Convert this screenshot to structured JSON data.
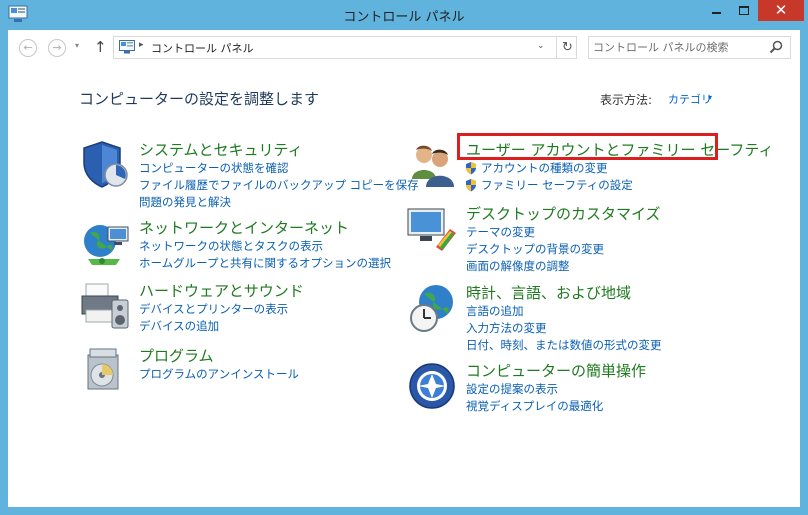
{
  "window": {
    "title": "コントロール パネル",
    "close_glyph": "✕"
  },
  "nav": {
    "back_glyph": "←",
    "forward_glyph": "→",
    "dropdown_glyph": "▾",
    "up_glyph": "↑",
    "separator": "▸",
    "address": "コントロール パネル",
    "address_dropdown": "⌄",
    "refresh_glyph": "↻",
    "search_placeholder": "コントロール パネルの検索"
  },
  "page": {
    "heading": "コンピューターの設定を調整します",
    "view_by_label": "表示方法:",
    "view_by_value": "カテゴリ",
    "view_by_arrow": "▾"
  },
  "categories_left": [
    {
      "title": "システムとセキュリティ",
      "icon": "shield-icon",
      "links": [
        "コンピューターの状態を確認",
        "ファイル履歴でファイルのバックアップ コピーを保存",
        "問題の発見と解決"
      ]
    },
    {
      "title": "ネットワークとインターネット",
      "icon": "network-globe-icon",
      "links": [
        "ネットワークの状態とタスクの表示",
        "ホームグループと共有に関するオプションの選択"
      ]
    },
    {
      "title": "ハードウェアとサウンド",
      "icon": "printer-speaker-icon",
      "links": [
        "デバイスとプリンターの表示",
        "デバイスの追加"
      ]
    },
    {
      "title": "プログラム",
      "icon": "programs-icon",
      "links": [
        "プログラムのアンインストール"
      ]
    }
  ],
  "categories_right": [
    {
      "title": "ユーザー アカウントとファミリー セーフティ",
      "icon": "users-icon",
      "links": [
        "アカウントの種類の変更",
        "ファミリー セーフティの設定"
      ],
      "shielded": true
    },
    {
      "title": "デスクトップのカスタマイズ",
      "icon": "desktop-icon",
      "links": [
        "テーマの変更",
        "デスクトップの背景の変更",
        "画面の解像度の調整"
      ]
    },
    {
      "title": "時計、言語、および地域",
      "icon": "clock-globe-icon",
      "links": [
        "言語の追加",
        "入力方法の変更",
        "日付、時刻、または数値の形式の変更"
      ]
    },
    {
      "title": "コンピューターの簡単操作",
      "icon": "ease-of-access-icon",
      "links": [
        "設定の提案の表示",
        "視覚ディスプレイの最適化"
      ]
    }
  ],
  "colors": {
    "frame": "#5fb3dc",
    "category_title": "#1f7a1f",
    "link": "#0a5fb2",
    "highlight_border": "#dc1e1e",
    "close_button": "#c7372a"
  }
}
